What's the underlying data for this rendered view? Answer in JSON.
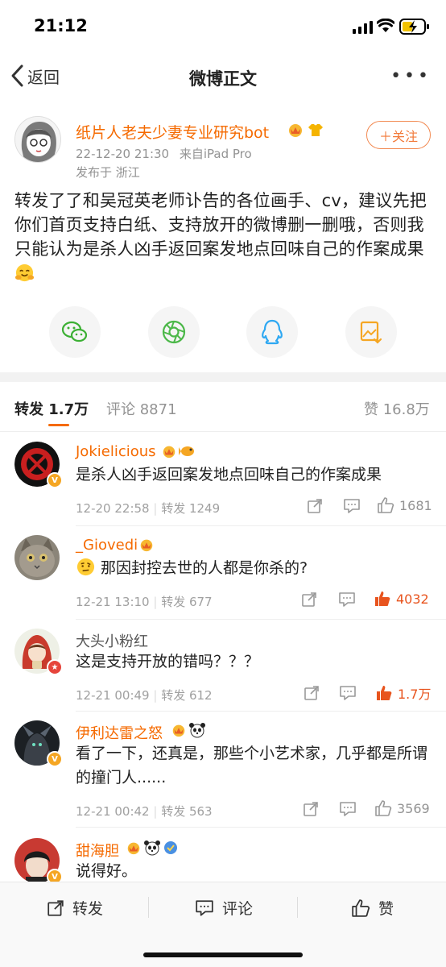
{
  "status_bar": {
    "time": "21:12"
  },
  "nav": {
    "back_label": "返回",
    "title": "微博正文",
    "more_label": "•••"
  },
  "post": {
    "author": "纸片人老夫少妻专业研究bot",
    "time": "22-12-20 21:30",
    "source": "来自iPad Pro",
    "location": "发布于 浙江",
    "follow_label": "＋关注",
    "text": "转发了了和吴冠英老师讣告的各位画手、cv，建议先把你们首页支持白纸、支持放开的微博删一删哦，否则我只能认为是杀人凶手返回案发地点回味自己的作案成果",
    "share": [
      "wechat-icon",
      "moments-icon",
      "qq-icon",
      "save-image-icon"
    ]
  },
  "tabs": {
    "repost": "转发 1.7万",
    "comments": "评论 8871",
    "likes": "赞 16.8万"
  },
  "comments": [
    {
      "name": "Jokielicious",
      "text": "是杀人凶手返回案发地点回味自己的作案成果",
      "time": "12-20 22:58",
      "reposts": "转发 1249",
      "likes": "1681",
      "liked": false
    },
    {
      "name": "_Giovedi",
      "text": "那因封控去世的人都是你杀的?",
      "time": "12-21 13:10",
      "reposts": "转发 677",
      "likes": "4032",
      "liked": true
    },
    {
      "name": "大头小粉红",
      "text": "这是支持开放的错吗？？？",
      "time": "12-21 00:49",
      "reposts": "转发 612",
      "likes": "1.7万",
      "liked": true
    },
    {
      "name": "伊利达雷之怒",
      "text": "看了一下，还真是，那些个小艺术家，几乎都是所谓的撞门人......",
      "time": "12-21 00:42",
      "reposts": "转发 563",
      "likes": "3569",
      "liked": false
    },
    {
      "name": "甜海胆",
      "text": "说得好。"
    }
  ],
  "bottom_bar": {
    "repost": "转发",
    "comment": "评论",
    "like": "赞"
  },
  "colors": {
    "accent": "#f56a00",
    "liked": "#e8541e",
    "meta": "#939393"
  }
}
